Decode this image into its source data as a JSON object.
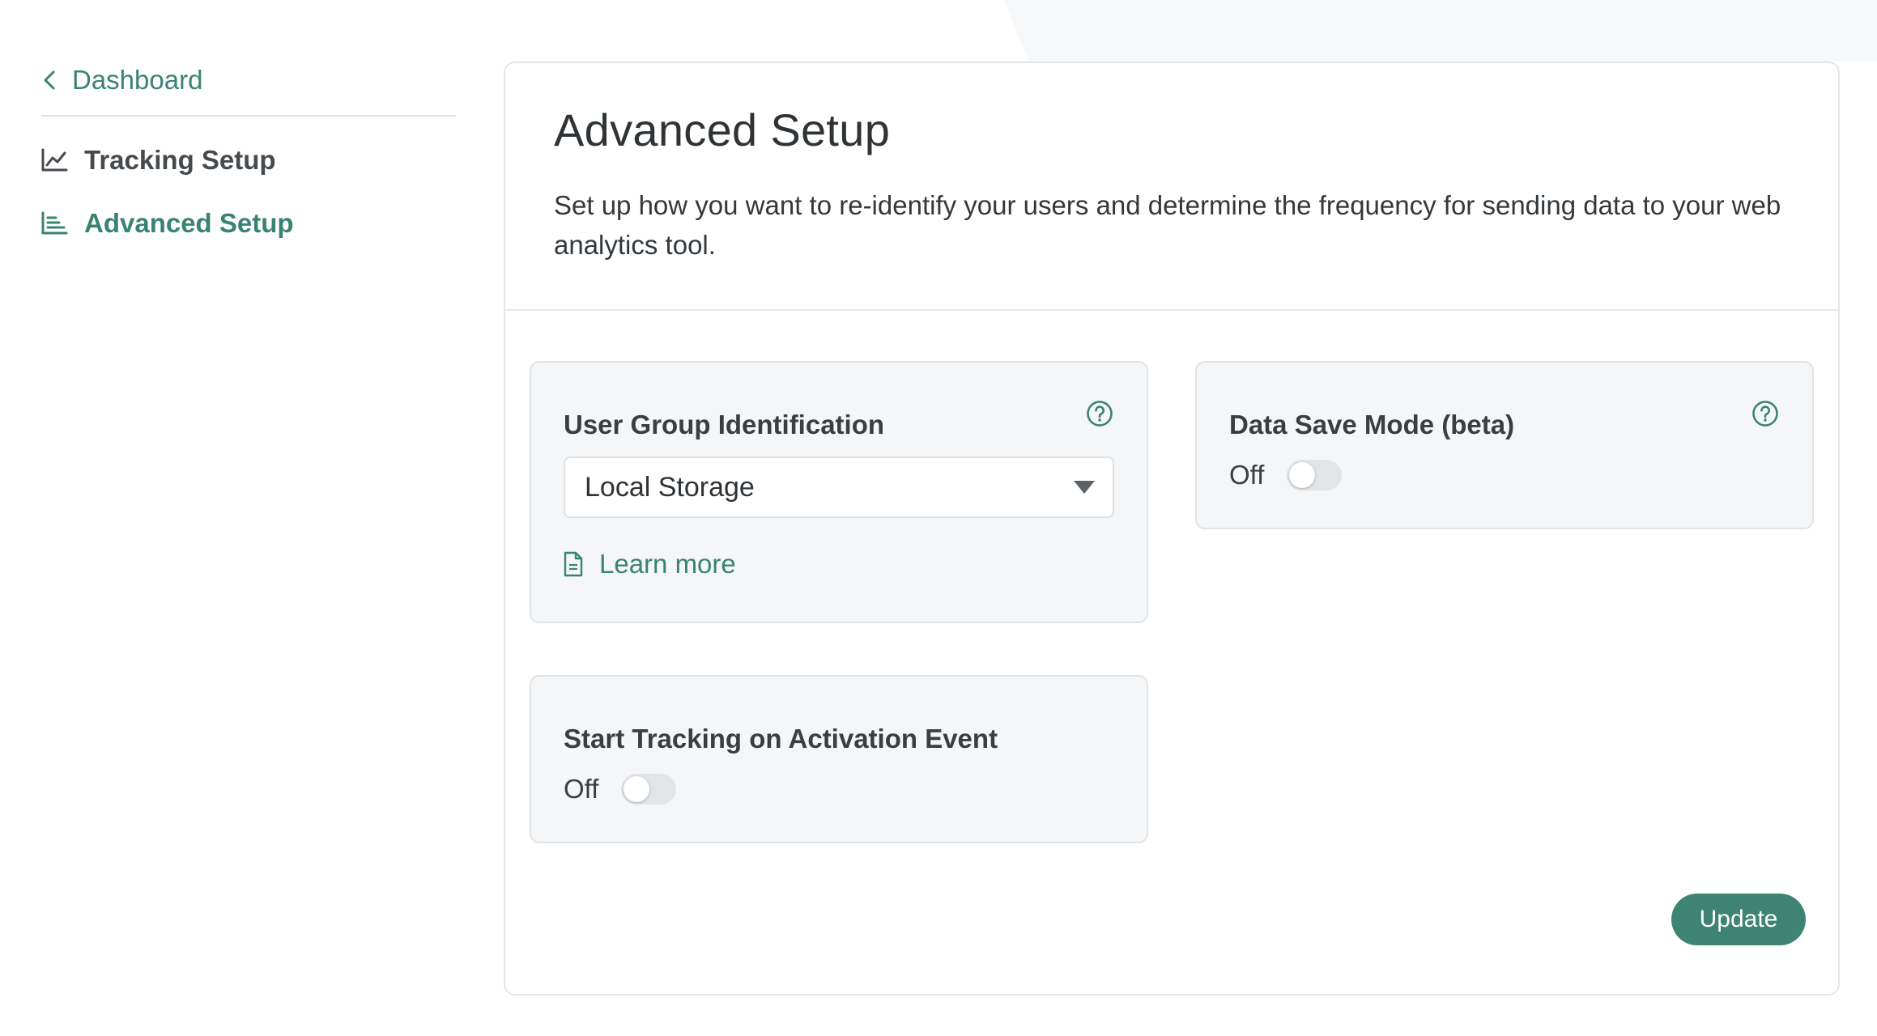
{
  "sidebar": {
    "back_label": "Dashboard",
    "items": [
      {
        "label": "Tracking Setup",
        "icon": "line-chart-icon",
        "active": false
      },
      {
        "label": "Advanced Setup",
        "icon": "bar-list-icon",
        "active": true
      }
    ]
  },
  "main": {
    "title": "Advanced Setup",
    "description": "Set up how you want to re-identify your users and determine the frequency for sending data to your web analytics tool."
  },
  "user_group": {
    "title": "User Group Identification",
    "selected_option": "Local Storage",
    "learn_more_label": "Learn more"
  },
  "data_save": {
    "title": "Data Save Mode (beta)",
    "state_label": "Off",
    "enabled": false
  },
  "activation": {
    "title": "Start Tracking on Activation Event",
    "state_label": "Off",
    "enabled": false
  },
  "actions": {
    "update_label": "Update"
  },
  "colors": {
    "accent": "#3a8373",
    "panel_bg": "#f4f6f8",
    "button_bg": "#3f8373"
  }
}
